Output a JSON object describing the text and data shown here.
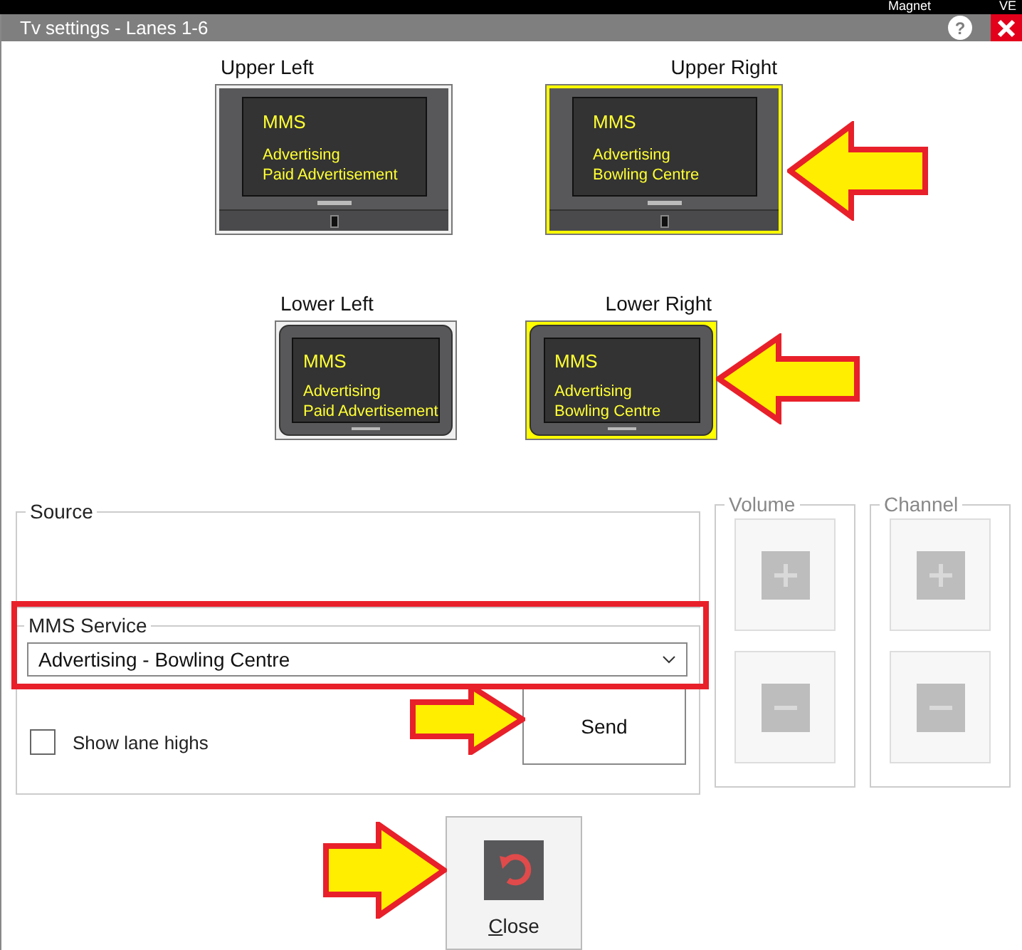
{
  "background_bar": {
    "texts": [
      "Magnet",
      "VE"
    ]
  },
  "window": {
    "title": "Tv settings - Lanes 1-6",
    "help": "?"
  },
  "screens": [
    {
      "label": "Upper Left",
      "kind": "wide",
      "selected": false,
      "title": "MMS",
      "lines": [
        "Advertising",
        "Paid Advertisement"
      ]
    },
    {
      "label": "Upper Right",
      "kind": "wide",
      "selected": true,
      "title": "MMS",
      "lines": [
        "Advertising",
        "Bowling Centre"
      ]
    },
    {
      "label": "Lower Left",
      "kind": "rounded",
      "selected": false,
      "title": "MMS",
      "lines": [
        "Advertising",
        "Paid Advertisement"
      ]
    },
    {
      "label": "Lower Right",
      "kind": "rounded",
      "selected": true,
      "title": "MMS",
      "lines": [
        "Advertising",
        "Bowling Centre"
      ]
    }
  ],
  "source": {
    "legend": "Source"
  },
  "mms_service": {
    "legend": "MMS Service",
    "value": "Advertising - Bowling Centre"
  },
  "show_lane_highs": {
    "label": "Show lane highs",
    "checked": false
  },
  "send_button": {
    "label": "Send"
  },
  "volume": {
    "legend": "Volume",
    "disabled": true
  },
  "channel": {
    "legend": "Channel",
    "disabled": true
  },
  "close_button": {
    "label": "Close"
  }
}
